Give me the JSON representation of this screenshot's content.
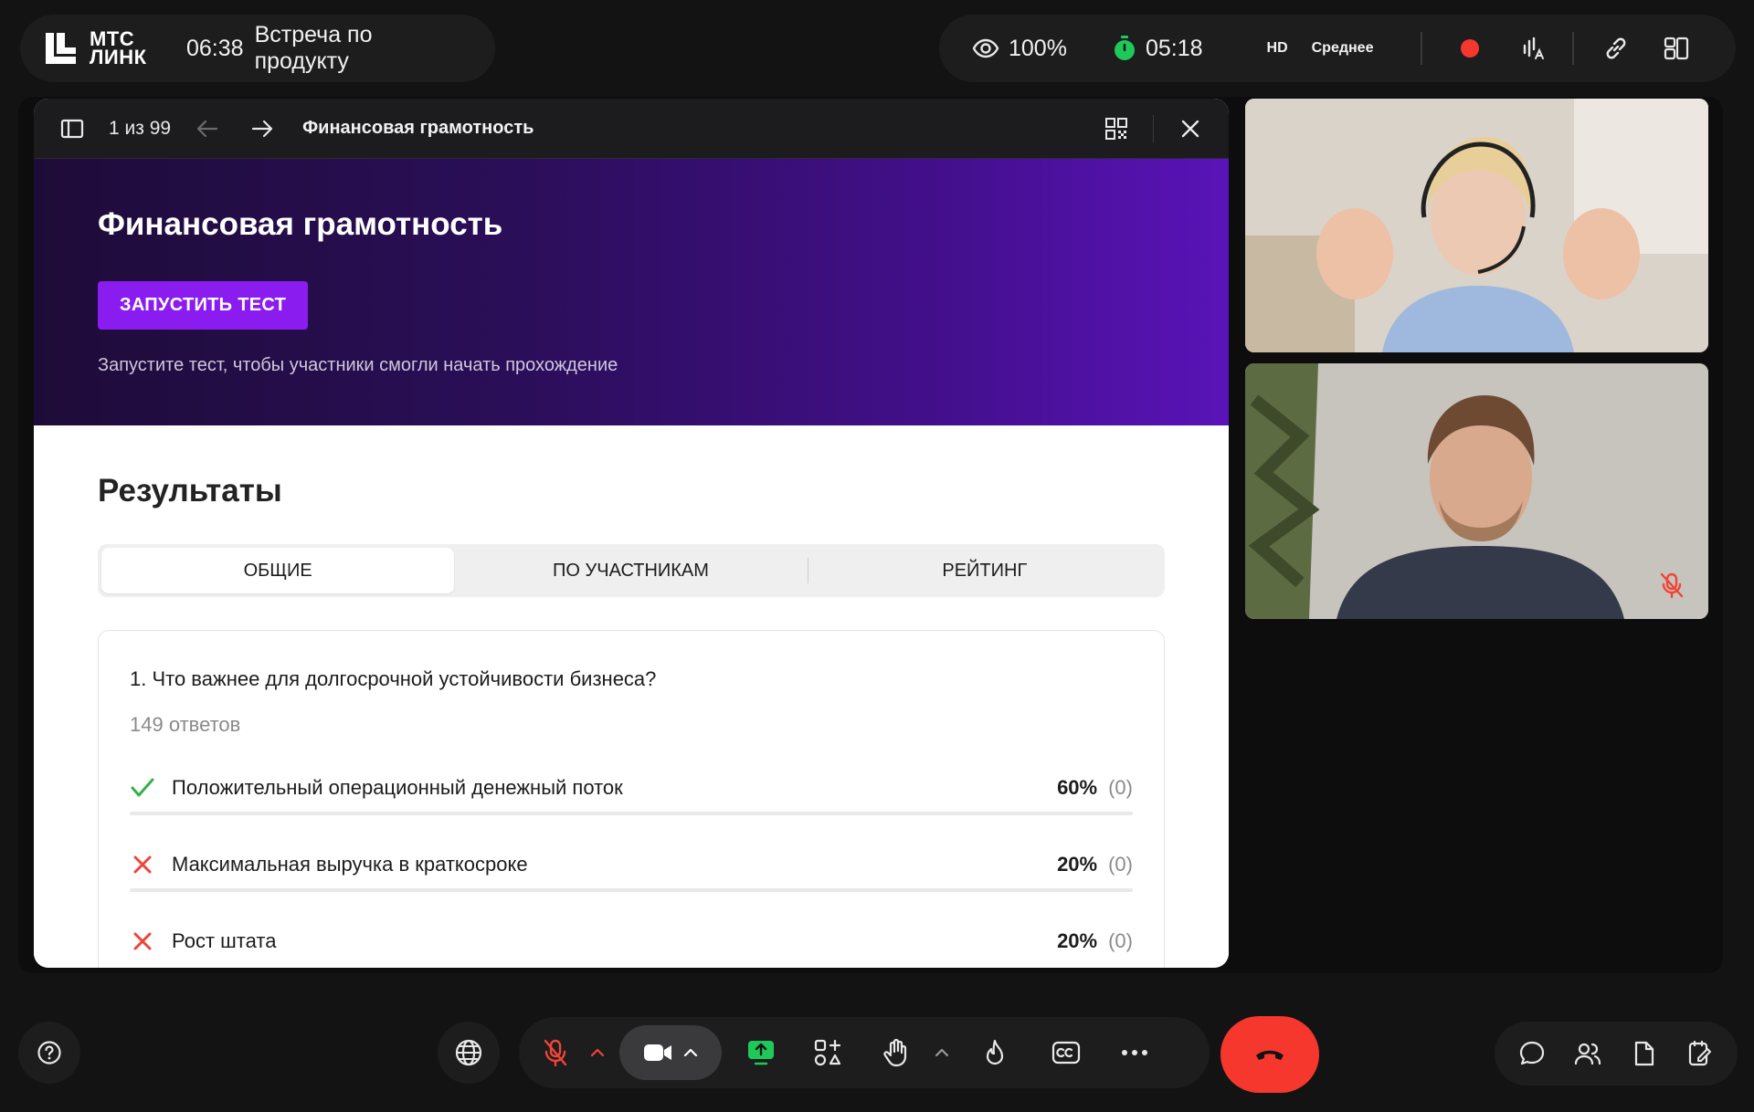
{
  "header": {
    "logo_line1": "МТС",
    "logo_line2": "ЛИНК",
    "meeting_time": "06:38",
    "meeting_title": "Встреча по продукту",
    "viewers_percent": "100%",
    "timer": "05:18",
    "quality_badge": "HD",
    "quality_level": "Среднее",
    "recording_color": "#f5372e",
    "timer_color": "#1ec95a"
  },
  "presentation": {
    "counter": "1 из 99",
    "title": "Финансовая грамотность",
    "hero_title": "Финансовая грамотность",
    "start_button": "ЗАПУСТИТЬ ТЕСТ",
    "hero_hint": "Запустите тест, чтобы участники смогли начать прохождение",
    "accent_color": "#8a1cf0",
    "results": {
      "title": "Результаты",
      "tabs": [
        {
          "label": "ОБЩИЕ",
          "active": true
        },
        {
          "label": "ПО УЧАСТНИКАМ",
          "active": false
        },
        {
          "label": "РЕЙТИНГ",
          "active": false
        }
      ],
      "question": {
        "title": "1. Что важнее для долгосрочной устойчивости бизнеса?",
        "responses": "149 ответов",
        "answers": [
          {
            "text": "Положительный операционный денежный поток",
            "percent": "60%",
            "count": "(0)",
            "correct": true,
            "share": 0.6
          },
          {
            "text": "Максимальная выручка в краткосроке",
            "percent": "20%",
            "count": "(0)",
            "correct": false,
            "share": 0.2
          },
          {
            "text": "Рост штата",
            "percent": "20%",
            "count": "(0)",
            "correct": false,
            "share": 0.2
          }
        ]
      }
    }
  },
  "participants": [
    {
      "icon": "participant-video-woman",
      "muted": false
    },
    {
      "icon": "participant-video-man",
      "muted": true
    }
  ],
  "icons": {
    "help": "question-icon",
    "globe": "globe-icon",
    "mic": "mic-off-icon",
    "camera": "camera-icon",
    "share": "screen-share-icon",
    "apps": "apps-icon",
    "hand": "raise-hand-icon",
    "reaction": "fire-icon",
    "captions": "cc-icon",
    "more": "more-icon",
    "end": "end-call-icon",
    "chat": "chat-icon",
    "people": "people-icon",
    "files": "files-icon",
    "notes": "notes-icon"
  }
}
